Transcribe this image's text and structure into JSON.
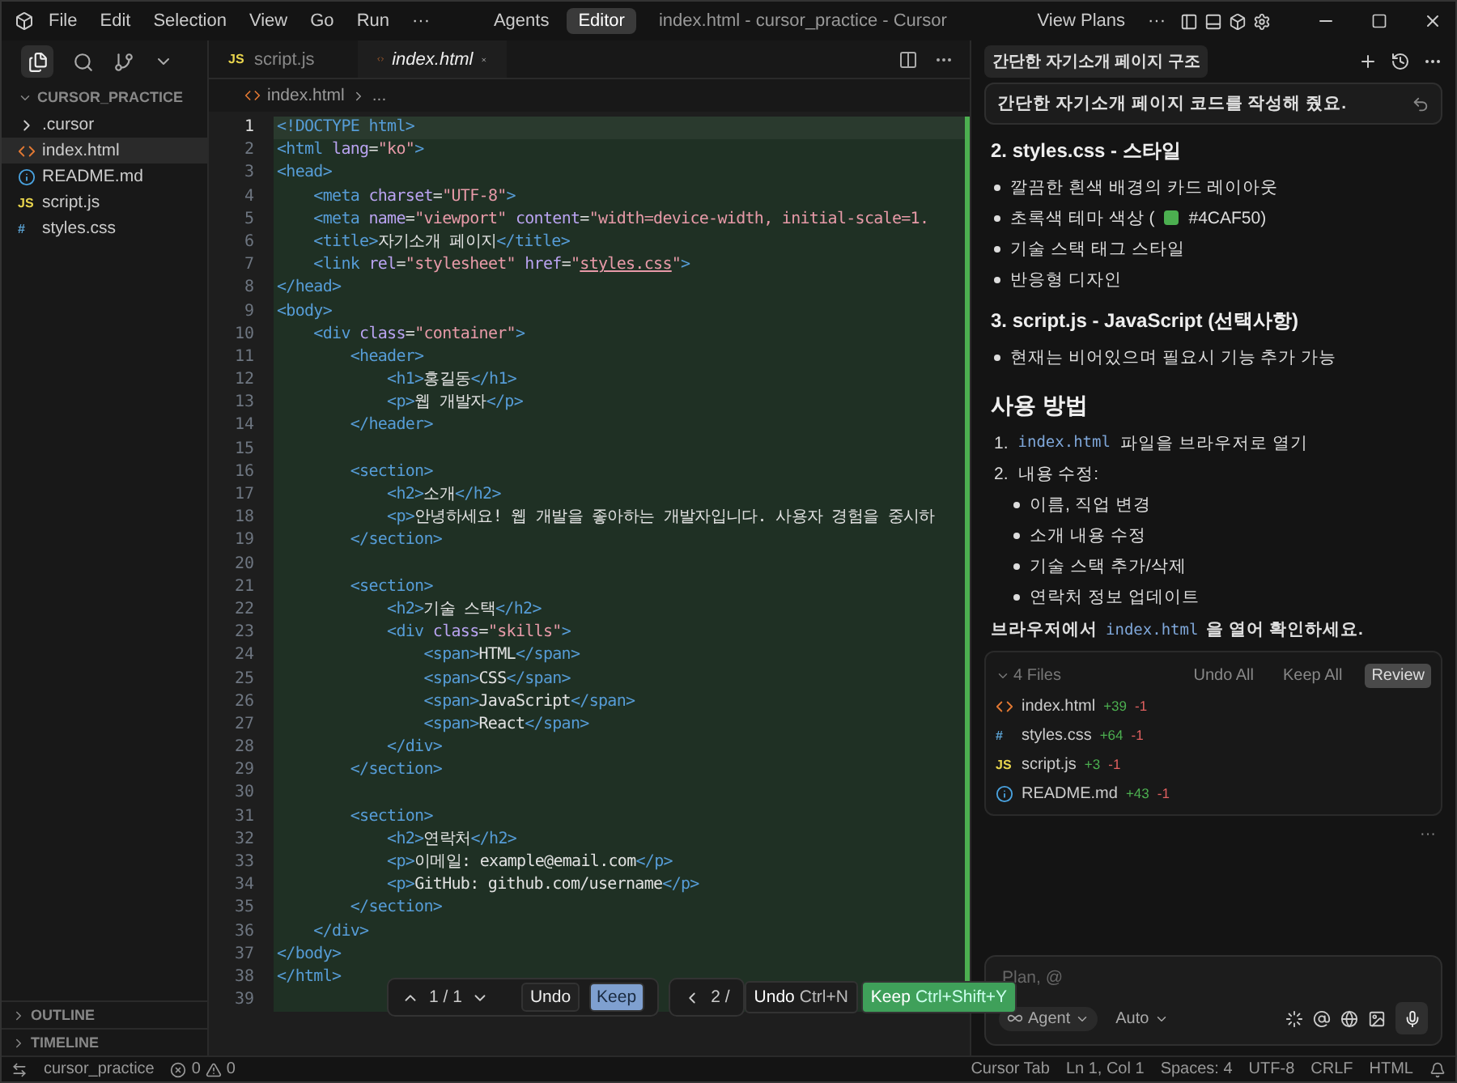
{
  "titlebar": {
    "menus": [
      "File",
      "Edit",
      "Selection",
      "View",
      "Go",
      "Run",
      "···"
    ],
    "modes": [
      {
        "label": "Agents",
        "selected": false
      },
      {
        "label": "Editor",
        "selected": true
      }
    ],
    "title": "index.html - cursor_practice - Cursor",
    "view_plans": "View Plans",
    "more": "···"
  },
  "sidebar": {
    "project": "CURSOR_PRACTICE",
    "items": [
      {
        "kind": "folder",
        "name": ".cursor",
        "selected": false
      },
      {
        "kind": "html",
        "name": "index.html",
        "selected": true
      },
      {
        "kind": "md",
        "name": "README.md",
        "selected": false
      },
      {
        "kind": "js",
        "badge": "JS",
        "name": "script.js",
        "selected": false
      },
      {
        "kind": "css",
        "badge": "#",
        "name": "styles.css",
        "selected": false
      }
    ],
    "panels": [
      "OUTLINE",
      "TIMELINE"
    ]
  },
  "tabs": [
    {
      "kind": "js",
      "badge": "JS",
      "label": "script.js",
      "selected": false
    },
    {
      "kind": "html",
      "label": "index.html",
      "selected": true
    }
  ],
  "breadcrumb": [
    "index.html",
    "..."
  ],
  "editor": {
    "lines": [
      {
        "number": "1",
        "active": true,
        "tokens": [
          {
            "kind": "tag",
            "text": "<!DOCTYPE html>"
          }
        ]
      },
      {
        "number": "2",
        "active": false,
        "tokens": [
          {
            "kind": "tag",
            "text": "<html"
          },
          {
            "kind": "attr",
            "text": " lang"
          },
          {
            "kind": "text",
            "text": "="
          },
          {
            "kind": "str",
            "text": "\"ko\""
          },
          {
            "kind": "tag",
            "text": ">"
          }
        ]
      },
      {
        "number": "3",
        "active": false,
        "tokens": [
          {
            "kind": "tag",
            "text": "<head>"
          }
        ]
      },
      {
        "number": "4",
        "active": false,
        "tokens": [
          {
            "kind": "tag",
            "text": "    <meta"
          },
          {
            "kind": "attr",
            "text": " charset"
          },
          {
            "kind": "text",
            "text": "="
          },
          {
            "kind": "str",
            "text": "\"UTF-8\""
          },
          {
            "kind": "tag",
            "text": ">"
          }
        ]
      },
      {
        "number": "5",
        "active": false,
        "tokens": [
          {
            "kind": "tag",
            "text": "    <meta"
          },
          {
            "kind": "attr",
            "text": " name"
          },
          {
            "kind": "text",
            "text": "="
          },
          {
            "kind": "str",
            "text": "\"viewport\""
          },
          {
            "kind": "attr",
            "text": " content"
          },
          {
            "kind": "text",
            "text": "="
          },
          {
            "kind": "str",
            "text": "\"width=device-width, initial-scale=1."
          }
        ]
      },
      {
        "number": "6",
        "active": false,
        "tokens": [
          {
            "kind": "tag",
            "text": "    <title>"
          },
          {
            "kind": "text",
            "text": "자기소개 페이지"
          },
          {
            "kind": "tag",
            "text": "</title>"
          }
        ]
      },
      {
        "number": "7",
        "active": false,
        "tokens": [
          {
            "kind": "tag",
            "text": "    <link"
          },
          {
            "kind": "attr",
            "text": " rel"
          },
          {
            "kind": "text",
            "text": "="
          },
          {
            "kind": "str",
            "text": "\"stylesheet\""
          },
          {
            "kind": "attr",
            "text": " href"
          },
          {
            "kind": "text",
            "text": "="
          },
          {
            "kind": "str",
            "text": "\""
          },
          {
            "kind": "link",
            "text": "styles.css"
          },
          {
            "kind": "str",
            "text": "\""
          },
          {
            "kind": "tag",
            "text": ">"
          }
        ]
      },
      {
        "number": "8",
        "active": false,
        "tokens": [
          {
            "kind": "tag",
            "text": "</head>"
          }
        ]
      },
      {
        "number": "9",
        "active": false,
        "tokens": [
          {
            "kind": "tag",
            "text": "<body>"
          }
        ]
      },
      {
        "number": "10",
        "active": false,
        "tokens": [
          {
            "kind": "tag",
            "text": "    <div"
          },
          {
            "kind": "attr",
            "text": " class"
          },
          {
            "kind": "text",
            "text": "="
          },
          {
            "kind": "str",
            "text": "\"container\""
          },
          {
            "kind": "tag",
            "text": ">"
          }
        ]
      },
      {
        "number": "11",
        "active": false,
        "tokens": [
          {
            "kind": "tag",
            "text": "        <header>"
          }
        ]
      },
      {
        "number": "12",
        "active": false,
        "tokens": [
          {
            "kind": "tag",
            "text": "            <h1>"
          },
          {
            "kind": "text",
            "text": "홍길동"
          },
          {
            "kind": "tag",
            "text": "</h1>"
          }
        ]
      },
      {
        "number": "13",
        "active": false,
        "tokens": [
          {
            "kind": "tag",
            "text": "            <p>"
          },
          {
            "kind": "text",
            "text": "웹 개발자"
          },
          {
            "kind": "tag",
            "text": "</p>"
          }
        ]
      },
      {
        "number": "14",
        "active": false,
        "tokens": [
          {
            "kind": "tag",
            "text": "        </header>"
          }
        ]
      },
      {
        "number": "15",
        "active": false
      },
      {
        "number": "16",
        "active": false,
        "tokens": [
          {
            "kind": "tag",
            "text": "        <section>"
          }
        ]
      },
      {
        "number": "17",
        "active": false,
        "tokens": [
          {
            "kind": "tag",
            "text": "            <h2>"
          },
          {
            "kind": "text",
            "text": "소개"
          },
          {
            "kind": "tag",
            "text": "</h2>"
          }
        ]
      },
      {
        "number": "18",
        "active": false,
        "tokens": [
          {
            "kind": "tag",
            "text": "            <p>"
          },
          {
            "kind": "text",
            "text": "안녕하세요! 웹 개발을 좋아하는 개발자입니다. 사용자 경험을 중시하"
          }
        ]
      },
      {
        "number": "19",
        "active": false,
        "tokens": [
          {
            "kind": "tag",
            "text": "        </section>"
          }
        ]
      },
      {
        "number": "20",
        "active": false
      },
      {
        "number": "21",
        "active": false,
        "tokens": [
          {
            "kind": "tag",
            "text": "        <section>"
          }
        ]
      },
      {
        "number": "22",
        "active": false,
        "tokens": [
          {
            "kind": "tag",
            "text": "            <h2>"
          },
          {
            "kind": "text",
            "text": "기술 스택"
          },
          {
            "kind": "tag",
            "text": "</h2>"
          }
        ]
      },
      {
        "number": "23",
        "active": false,
        "tokens": [
          {
            "kind": "tag",
            "text": "            <div"
          },
          {
            "kind": "attr",
            "text": " class"
          },
          {
            "kind": "text",
            "text": "="
          },
          {
            "kind": "str",
            "text": "\"skills\""
          },
          {
            "kind": "tag",
            "text": ">"
          }
        ]
      },
      {
        "number": "24",
        "active": false,
        "tokens": [
          {
            "kind": "tag",
            "text": "                <span>"
          },
          {
            "kind": "text",
            "text": "HTML"
          },
          {
            "kind": "tag",
            "text": "</span>"
          }
        ]
      },
      {
        "number": "25",
        "active": false,
        "tokens": [
          {
            "kind": "tag",
            "text": "                <span>"
          },
          {
            "kind": "text",
            "text": "CSS"
          },
          {
            "kind": "tag",
            "text": "</span>"
          }
        ]
      },
      {
        "number": "26",
        "active": false,
        "tokens": [
          {
            "kind": "tag",
            "text": "                <span>"
          },
          {
            "kind": "text",
            "text": "JavaScript"
          },
          {
            "kind": "tag",
            "text": "</span>"
          }
        ]
      },
      {
        "number": "27",
        "active": false,
        "tokens": [
          {
            "kind": "tag",
            "text": "                <span>"
          },
          {
            "kind": "text",
            "text": "React"
          },
          {
            "kind": "tag",
            "text": "</span>"
          }
        ]
      },
      {
        "number": "28",
        "active": false,
        "tokens": [
          {
            "kind": "tag",
            "text": "            </div>"
          }
        ]
      },
      {
        "number": "29",
        "active": false,
        "tokens": [
          {
            "kind": "tag",
            "text": "        </section>"
          }
        ]
      },
      {
        "number": "30",
        "active": false
      },
      {
        "number": "31",
        "active": false,
        "tokens": [
          {
            "kind": "tag",
            "text": "        <section>"
          }
        ]
      },
      {
        "number": "32",
        "active": false,
        "tokens": [
          {
            "kind": "tag",
            "text": "            <h2>"
          },
          {
            "kind": "text",
            "text": "연락처"
          },
          {
            "kind": "tag",
            "text": "</h2>"
          }
        ]
      },
      {
        "number": "33",
        "active": false,
        "tokens": [
          {
            "kind": "tag",
            "text": "            <p>"
          },
          {
            "kind": "text",
            "text": "이메일: example@email.com"
          },
          {
            "kind": "tag",
            "text": "</p>"
          }
        ]
      },
      {
        "number": "34",
        "active": false,
        "tokens": [
          {
            "kind": "tag",
            "text": "            <p>"
          },
          {
            "kind": "text",
            "text": "GitHub: github.com/username"
          },
          {
            "kind": "tag",
            "text": "</p>"
          }
        ]
      },
      {
        "number": "35",
        "active": false,
        "tokens": [
          {
            "kind": "tag",
            "text": "        </section>"
          }
        ]
      },
      {
        "number": "36",
        "active": false,
        "tokens": [
          {
            "kind": "tag",
            "text": "    </div>"
          }
        ]
      },
      {
        "number": "37",
        "active": false,
        "tokens": [
          {
            "kind": "tag",
            "text": "</body>"
          }
        ]
      },
      {
        "number": "38",
        "active": false,
        "tokens": [
          {
            "kind": "tag",
            "text": "</html>"
          }
        ]
      },
      {
        "number": "39",
        "active": false
      }
    ],
    "review_bar": {
      "counter": "1 / 1",
      "undo": "Undo",
      "keep": "Keep",
      "file_counter": "2 /"
    },
    "tooltip": {
      "undo": "Undo",
      "undo_key": "Ctrl+N",
      "keep": "Keep",
      "keep_key": "Ctrl+Shift+Y"
    }
  },
  "chat": {
    "title": "간단한 자기소개 페이지 구조",
    "message": "간단한 자기소개 페이지 코드를 작성해 줬요.",
    "blocks": [
      {
        "kind": "heading3",
        "text": "2. styles.css - 스타일"
      },
      {
        "kind": "bullets",
        "items": [
          {
            "parts": [
              {
                "kind": "text",
                "text": "깔끔한 흰색 배경의 카드 레이아웃"
              }
            ]
          },
          {
            "parts": [
              {
                "kind": "text",
                "text": "초록색 테마 색상 ("
              },
              {
                "kind": "swatch",
                "color": "#4caf50"
              },
              {
                "kind": "text",
                "text": "#4CAF50)"
              }
            ]
          },
          {
            "parts": [
              {
                "kind": "text",
                "text": "기술 스택 태그 스타일"
              }
            ]
          },
          {
            "parts": [
              {
                "kind": "text",
                "text": "반응형 디자인"
              }
            ]
          }
        ]
      },
      {
        "kind": "heading3",
        "text": "3. script.js - JavaScript (선택사항)"
      },
      {
        "kind": "bullets",
        "items": [
          {
            "parts": [
              {
                "kind": "text",
                "text": "현재는 비어있으며 필요시 기능 추가 가능"
              }
            ]
          }
        ]
      },
      {
        "kind": "heading2",
        "text": "사용 방법"
      },
      {
        "kind": "ordered",
        "items": [
          {
            "number": "1.",
            "parts": [
              {
                "kind": "code",
                "text": "index.html"
              },
              {
                "kind": "text",
                "text": "파일을 브라우저로 열기"
              }
            ]
          },
          {
            "number": "2.",
            "parts": [
              {
                "kind": "text",
                "text": "내용 수정:"
              }
            ],
            "children": [
              {
                "parts": [
                  {
                    "kind": "text",
                    "text": "이름, 직업 변경"
                  }
                ]
              },
              {
                "parts": [
                  {
                    "kind": "text",
                    "text": "소개 내용 수정"
                  }
                ]
              },
              {
                "parts": [
                  {
                    "kind": "text",
                    "text": "기술 스택 추가/삭제"
                  }
                ]
              },
              {
                "parts": [
                  {
                    "kind": "text",
                    "text": "연락처 정보 업데이트"
                  }
                ]
              }
            ]
          }
        ]
      },
      {
        "kind": "paragraph",
        "parts": [
          {
            "kind": "text",
            "text": "브라우저에서"
          },
          {
            "kind": "code",
            "text": "index.html"
          },
          {
            "kind": "text",
            "text": "을 열어 확인하세요."
          }
        ]
      }
    ],
    "files_card": {
      "count": "4 Files",
      "undo_all": "Undo All",
      "keep_all": "Keep All",
      "review": "Review",
      "files": [
        {
          "kind": "html",
          "name": "index.html",
          "added": "+39",
          "removed": "-1"
        },
        {
          "kind": "css",
          "badge": "#",
          "name": "styles.css",
          "added": "+64",
          "removed": "-1"
        },
        {
          "kind": "js",
          "badge": "JS",
          "name": "script.js",
          "added": "+3",
          "removed": "-1"
        },
        {
          "kind": "md",
          "name": "README.md",
          "added": "+43",
          "removed": "-1"
        }
      ]
    },
    "more": "···",
    "input": {
      "placeholder": "Plan, @",
      "agent": "Agent",
      "model": "Auto"
    }
  },
  "status_bar": {
    "project": "cursor_practice",
    "errors": "0",
    "warnings": "0",
    "items": [
      "Cursor Tab",
      "Ln 1, Col 1",
      "Spaces: 4",
      "UTF-8",
      "CRLF",
      "HTML"
    ]
  }
}
